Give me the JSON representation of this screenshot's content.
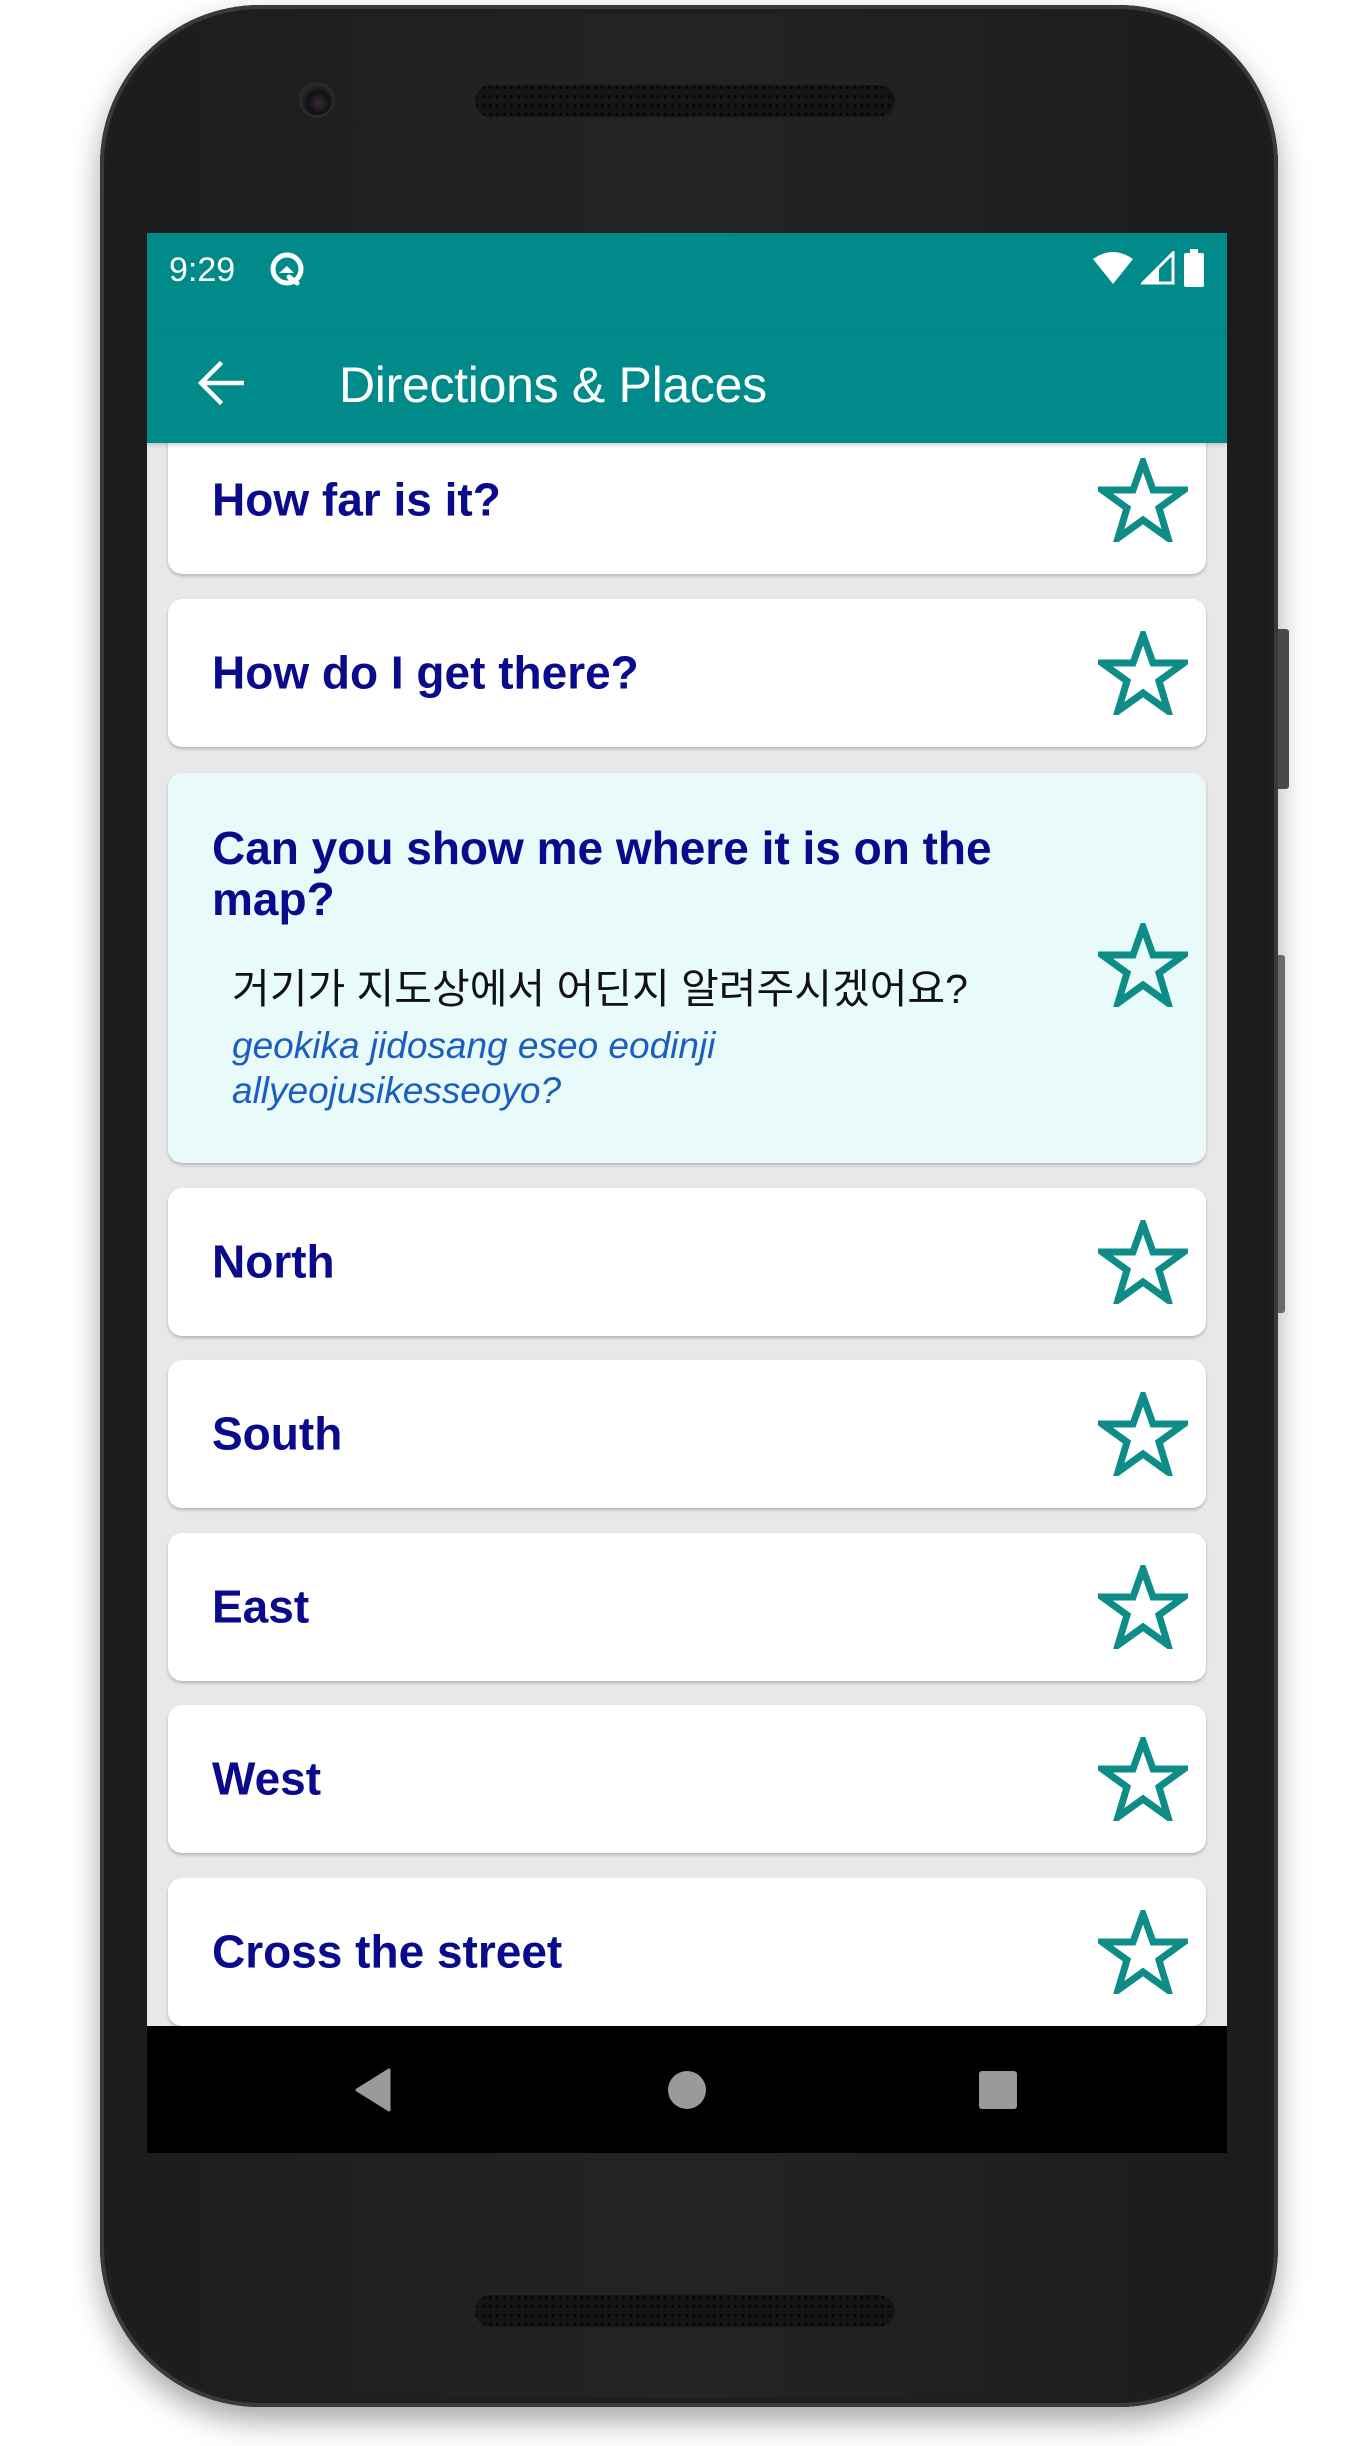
{
  "status_bar": {
    "time": "9:29",
    "left_icons": [
      "data-saver-icon"
    ],
    "right_icons": [
      "wifi-icon",
      "cell-signal-icon",
      "battery-icon"
    ]
  },
  "toolbar": {
    "back_icon": "arrow-back-icon",
    "title": "Directions & Places"
  },
  "colors": {
    "primary": "#008b8a",
    "phrase_text": "#0a0a8c",
    "romanization_text": "#1a5fbf",
    "star": "#0e8c88",
    "highlight_bg": "#e8fafa",
    "list_bg": "#e8e8e8"
  },
  "phrases": [
    {
      "english": "How far is it?",
      "favorite": false
    },
    {
      "english": "How do I get there?",
      "favorite": false
    },
    {
      "english": "Can you show me where it is on the map?",
      "korean": "거기가 지도상에서 어딘지 알려주시겠어요?",
      "romanization": "geokika jidosang eseo eodinji allyeojusikesseoyo?",
      "expanded": true,
      "favorite": false
    },
    {
      "english": "North",
      "favorite": false
    },
    {
      "english": "South",
      "favorite": false
    },
    {
      "english": "East",
      "favorite": false
    },
    {
      "english": "West",
      "favorite": false
    },
    {
      "english": "Cross the street",
      "favorite": false
    }
  ],
  "nav_bar": {
    "back": "nav-back-icon",
    "home": "nav-home-icon",
    "recents": "nav-recents-icon"
  }
}
